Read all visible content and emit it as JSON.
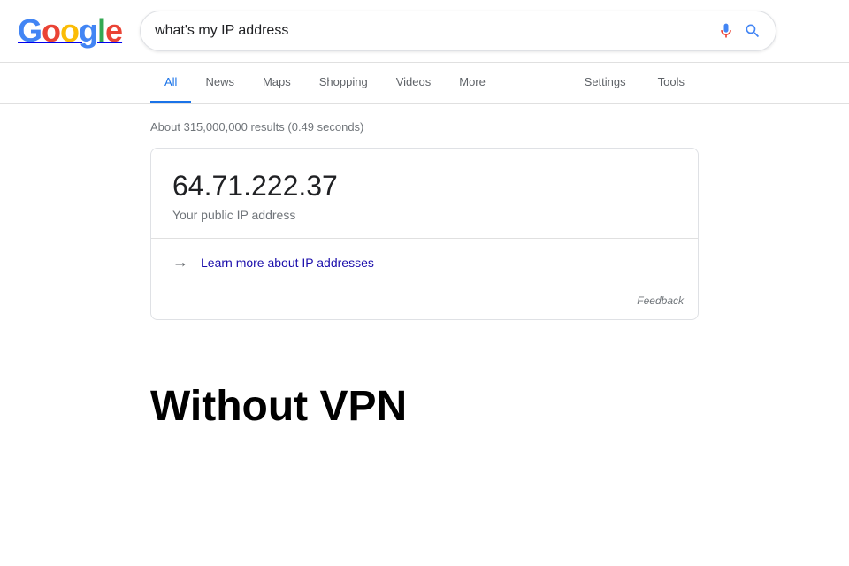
{
  "header": {
    "logo": {
      "letters": [
        "G",
        "o",
        "o",
        "g",
        "l",
        "e"
      ]
    },
    "search_query": "what's my IP address",
    "search_placeholder": "Search"
  },
  "nav": {
    "tabs_left": [
      {
        "id": "all",
        "label": "All",
        "active": true
      },
      {
        "id": "news",
        "label": "News",
        "active": false
      },
      {
        "id": "maps",
        "label": "Maps",
        "active": false
      },
      {
        "id": "shopping",
        "label": "Shopping",
        "active": false
      },
      {
        "id": "videos",
        "label": "Videos",
        "active": false
      },
      {
        "id": "more",
        "label": "More",
        "active": false
      }
    ],
    "tabs_right": [
      {
        "id": "settings",
        "label": "Settings"
      },
      {
        "id": "tools",
        "label": "Tools"
      }
    ]
  },
  "results": {
    "stats": "About 315,000,000 results (0.49 seconds)",
    "featured": {
      "ip_address": "64.71.222.37",
      "ip_label": "Your public IP address",
      "learn_more_text": "Learn more about IP addresses",
      "feedback_text": "Feedback"
    }
  },
  "page_label": {
    "without_vpn": "Without VPN"
  }
}
